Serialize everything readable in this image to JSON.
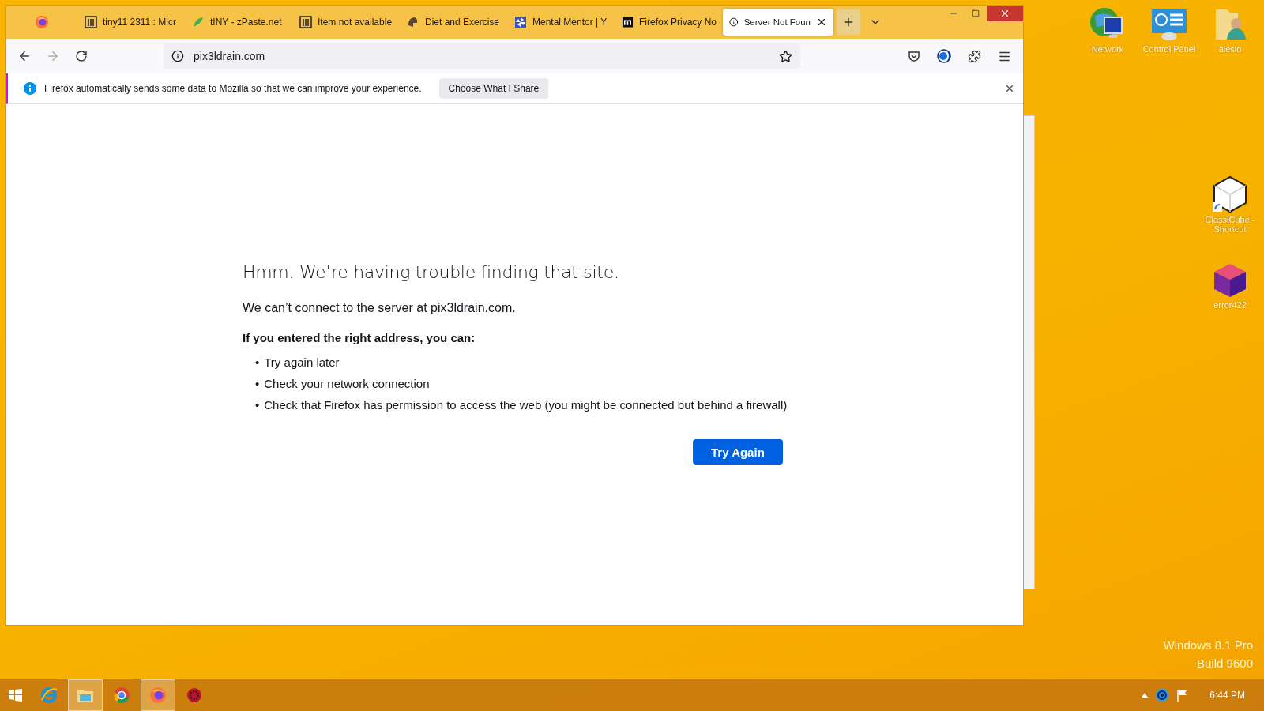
{
  "browser": {
    "tabs": [
      {
        "title": "tiny11 2311 : Micr",
        "kind": "archive",
        "selected": false
      },
      {
        "title": "tINY - zPaste.net",
        "kind": "leaf",
        "selected": false
      },
      {
        "title": "Item not available",
        "kind": "archive",
        "selected": false
      },
      {
        "title": "Diet and Exercise",
        "kind": "helmet",
        "selected": false
      },
      {
        "title": "Mental Mentor | Y",
        "kind": "pinwheel",
        "selected": false
      },
      {
        "title": "Firefox Privacy No",
        "kind": "letter",
        "selected": false
      },
      {
        "title": "Server Not Foun",
        "kind": "info",
        "selected": true
      }
    ],
    "address": "pix3ldrain.com",
    "notification": {
      "text": "Firefox automatically sends some data to Mozilla so that we can improve your experience.",
      "button": "Choose What I Share"
    },
    "error_page": {
      "title": "Hmm. We’re having trouble finding that site.",
      "message": "We can’t connect to the server at pix3ldrain.com.",
      "subtitle": "If you entered the right address, you can:",
      "bullet": "•",
      "suggestions": [
        "Try again later",
        "Check your network connection",
        "Check that Firefox has permission to access the web (you might be connected but behind a firewall)"
      ],
      "button": "Try Again"
    }
  },
  "desktop_icons": [
    {
      "label": "Network",
      "kind": "network"
    },
    {
      "label": "Control Panel",
      "kind": "control"
    },
    {
      "label": "alesio",
      "kind": "folder"
    },
    {
      "label": "ClassiCube - Shortcut",
      "kind": "cube"
    },
    {
      "label": "error422",
      "kind": "block"
    }
  ],
  "watermark": [
    "Windows 8.1 Pro",
    "Build 9600"
  ],
  "taskbar": {
    "apps": [
      {
        "kind": "ie",
        "selected": false
      },
      {
        "kind": "explorer",
        "selected": true
      },
      {
        "kind": "chrome",
        "selected": false
      },
      {
        "kind": "firefox",
        "selected": true
      },
      {
        "kind": "gear",
        "selected": false
      }
    ],
    "clock": "6:44 PM"
  }
}
